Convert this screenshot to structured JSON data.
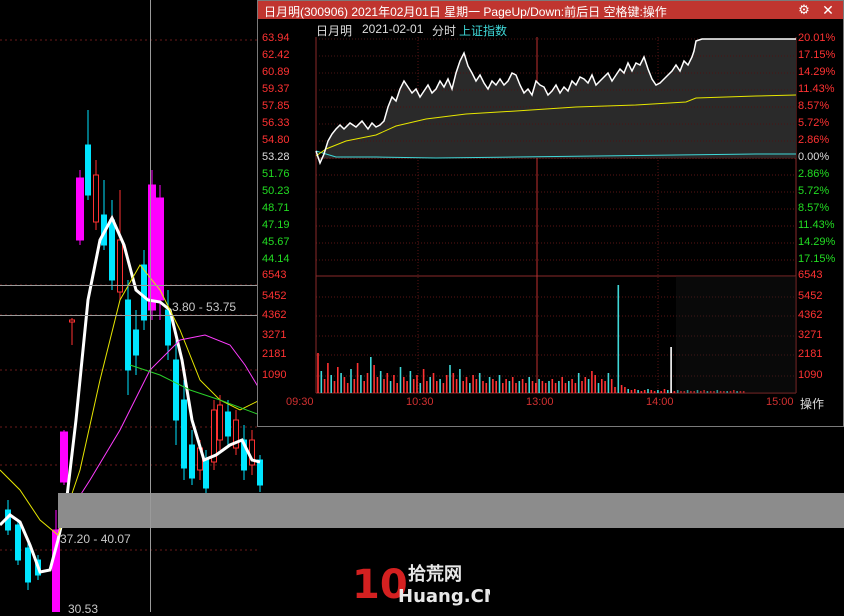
{
  "background": {
    "price_tags": [
      "3.80 - 53.75",
      "37.20 - 40.07",
      "30.53"
    ]
  },
  "window": {
    "title": "日月明(300906) 2021年02月01日 星期一 PageUp/Down:前后日 空格键:操作",
    "close_symbol": "✕",
    "gear_symbol": "⚙",
    "info": {
      "stock_name": "日月明",
      "date": "2021-02-01",
      "view": "分时",
      "index_link": "上证指数"
    },
    "price_axis_left": [
      "63.94",
      "62.42",
      "60.89",
      "59.37",
      "57.85",
      "56.33",
      "54.80",
      "53.28",
      "51.76",
      "50.23",
      "48.71",
      "47.19",
      "45.67",
      "44.14"
    ],
    "pct_axis_right": [
      "20.01%",
      "17.15%",
      "14.29%",
      "11.43%",
      "8.57%",
      "5.72%",
      "2.86%",
      "0.00%",
      "2.86%",
      "5.72%",
      "8.57%",
      "11.43%",
      "14.29%",
      "17.15%"
    ],
    "volume_axis": [
      "6543",
      "5452",
      "4362",
      "3271",
      "2181",
      "1090"
    ],
    "time_axis": [
      "09:30",
      "10:30",
      "13:00",
      "14:00",
      "15:00"
    ],
    "operate_label": "操作"
  },
  "watermark": {
    "number": "10",
    "brand_cn": "拾荒网",
    "brand_en": "Huang.CN"
  },
  "colors": {
    "up": "#ff3232",
    "down": "#00e5ff",
    "limit_up": "#ff00ff",
    "title_bg": "#c0352f",
    "price_line": "#ffffff",
    "avg_line": "#e6e600",
    "index_line": "#3fd8d8"
  }
}
